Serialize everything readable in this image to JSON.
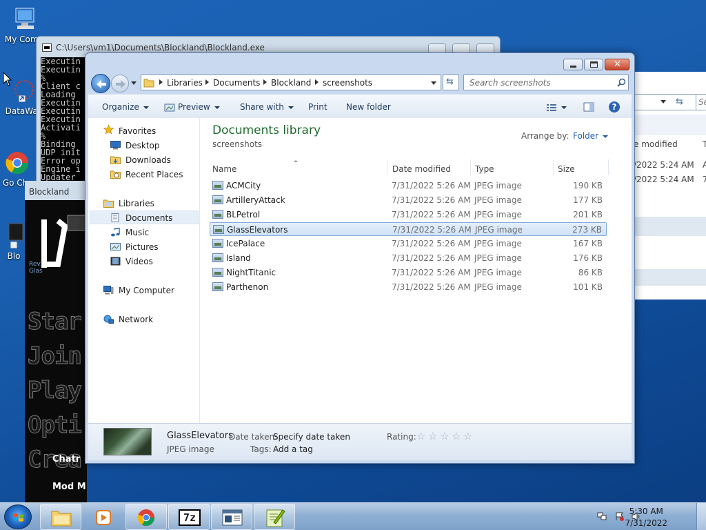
{
  "desktop": {
    "icons": [
      {
        "label": "My Comp"
      },
      {
        "label": "DataWag"
      },
      {
        "label": "Go Ch"
      },
      {
        "label": "Blo"
      }
    ]
  },
  "console": {
    "title": "C:\\Users\\vm1\\Documents\\Blockland\\Blockland.exe",
    "lines": [
      "Executin",
      "Executin",
      "%",
      "Client c",
      "Loading",
      "Executin",
      "Executin",
      "Executin",
      "Activati",
      "%",
      "Binding",
      "UDP init",
      "Error op",
      "Engine i",
      "Updater"
    ]
  },
  "blockland": {
    "title": "Blockland",
    "menu_items": [
      "Star",
      "Join",
      "Play",
      "Opti",
      "Crea"
    ],
    "chat_label": "Chatr",
    "mod_label": "Mod M",
    "logo_sub": "Revi Glas"
  },
  "background_explorer": {
    "col_date": "e modified",
    "col_t": "T",
    "dates": [
      "/2022 5:24 AM",
      "/2022 5:24 AM"
    ],
    "types": [
      "A",
      "7"
    ],
    "search_fragment": "Se"
  },
  "explorer": {
    "breadcrumbs": [
      "Libraries",
      "Documents",
      "Blockland",
      "screenshots"
    ],
    "search_placeholder": "Search screenshots",
    "toolbar": {
      "organize": "Organize",
      "preview": "Preview",
      "share_with": "Share with",
      "print": "Print",
      "new_folder": "New folder"
    },
    "nav": {
      "favorites": "Favorites",
      "desktop": "Desktop",
      "downloads": "Downloads",
      "recent_places": "Recent Places",
      "libraries": "Libraries",
      "documents": "Documents",
      "music": "Music",
      "pictures": "Pictures",
      "videos": "Videos",
      "my_computer": "My Computer",
      "network": "Network"
    },
    "library_title": "Documents library",
    "library_subtitle": "screenshots",
    "arrange_by_label": "Arrange by:",
    "arrange_by_value": "Folder",
    "columns": {
      "name": "Name",
      "date": "Date modified",
      "type": "Type",
      "size": "Size"
    },
    "files": [
      {
        "name": "ACMCity",
        "date": "7/31/2022 5:26 AM",
        "type": "JPEG image",
        "size": "190 KB"
      },
      {
        "name": "ArtilleryAttack",
        "date": "7/31/2022 5:26 AM",
        "type": "JPEG image",
        "size": "177 KB"
      },
      {
        "name": "BLPetrol",
        "date": "7/31/2022 5:26 AM",
        "type": "JPEG image",
        "size": "201 KB"
      },
      {
        "name": "GlassElevators",
        "date": "7/31/2022 5:26 AM",
        "type": "JPEG image",
        "size": "273 KB"
      },
      {
        "name": "IcePalace",
        "date": "7/31/2022 5:26 AM",
        "type": "JPEG image",
        "size": "167 KB"
      },
      {
        "name": "Island",
        "date": "7/31/2022 5:26 AM",
        "type": "JPEG image",
        "size": "176 KB"
      },
      {
        "name": "NightTitanic",
        "date": "7/31/2022 5:26 AM",
        "type": "JPEG image",
        "size": "86 KB"
      },
      {
        "name": "Parthenon",
        "date": "7/31/2022 5:26 AM",
        "type": "JPEG image",
        "size": "101 KB"
      }
    ],
    "selected_index": 3,
    "details": {
      "name": "GlassElevators",
      "type": "JPEG image",
      "date_taken_label": "Date taken:",
      "date_taken_value": "Specify date taken",
      "tags_label": "Tags:",
      "tags_value": "Add a tag",
      "rating_label": "Rating:",
      "rating_value": 0,
      "rating_max": 5
    }
  },
  "taskbar": {
    "time": "5:30 AM",
    "date": "7/31/2022",
    "sevenzip_label": "7z"
  },
  "colors": {
    "library_title": "#1e6a2d",
    "selection_border": "#84acdd",
    "link_blue": "#1f5fb0"
  }
}
